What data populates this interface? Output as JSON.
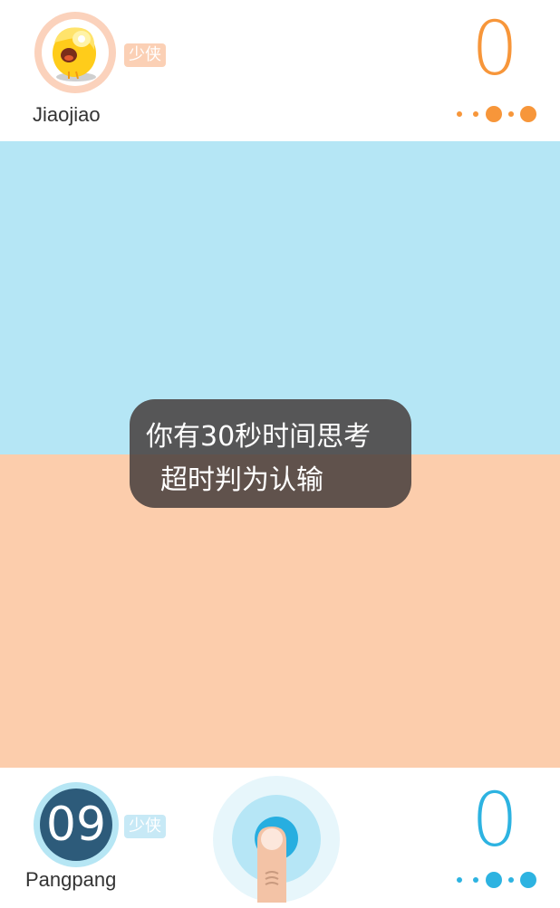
{
  "top_player": {
    "name": "Jiaojiao",
    "badge": "少侠",
    "score": "0",
    "avatar": "yellow-chick-icon",
    "color": "#f7963a"
  },
  "bottom_player": {
    "name": "Pangpang",
    "badge": "少侠",
    "score": "0",
    "countdown": "09",
    "color": "#2db3e1"
  },
  "toast": {
    "line1": "你有30秒时间思考",
    "line2": "超时判为认输"
  },
  "colors": {
    "blue_zone": "#b5e6f5",
    "orange_zone": "#fccdac"
  },
  "icons": {
    "touch": "finger-press-icon",
    "progress": "progress-dots-icon"
  }
}
